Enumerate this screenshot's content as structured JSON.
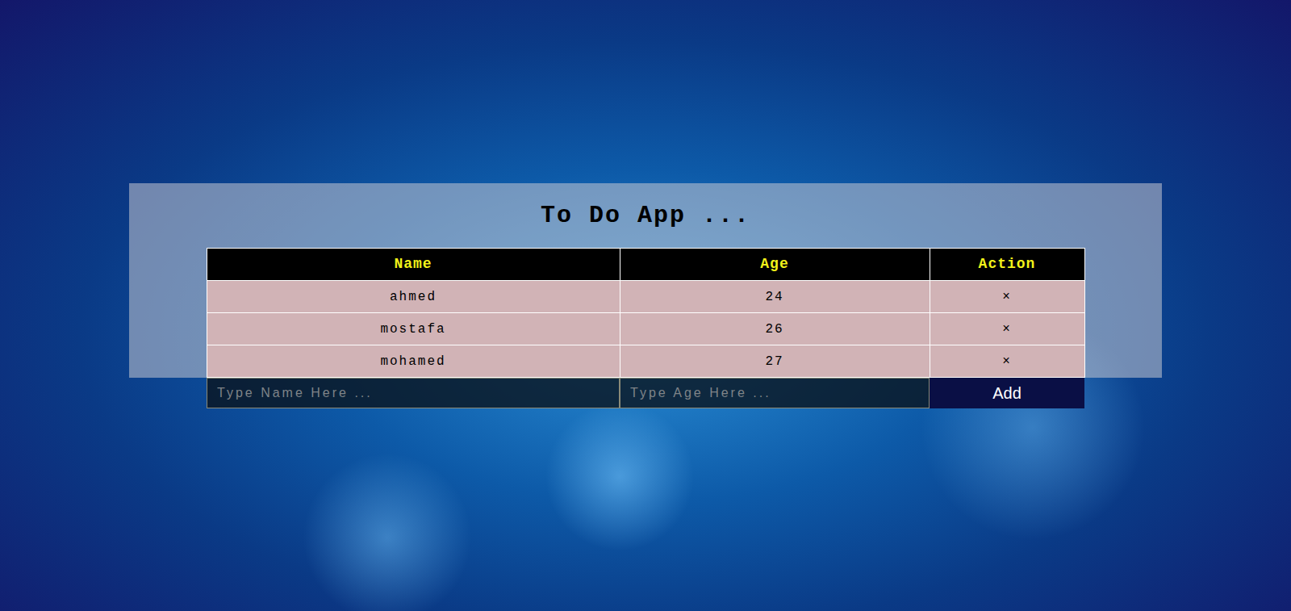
{
  "app": {
    "title": "To Do App ..."
  },
  "table": {
    "columns": [
      "Name",
      "Age",
      "Action"
    ],
    "rows": [
      {
        "name": "ahmed",
        "age": "24",
        "action": "×"
      },
      {
        "name": "mostafa",
        "age": "26",
        "action": "×"
      },
      {
        "name": "mohamed",
        "age": "27",
        "action": "×"
      }
    ]
  },
  "form": {
    "name_placeholder": "Type Name Here ...",
    "age_placeholder": "Type Age Here ...",
    "button": "Add"
  }
}
